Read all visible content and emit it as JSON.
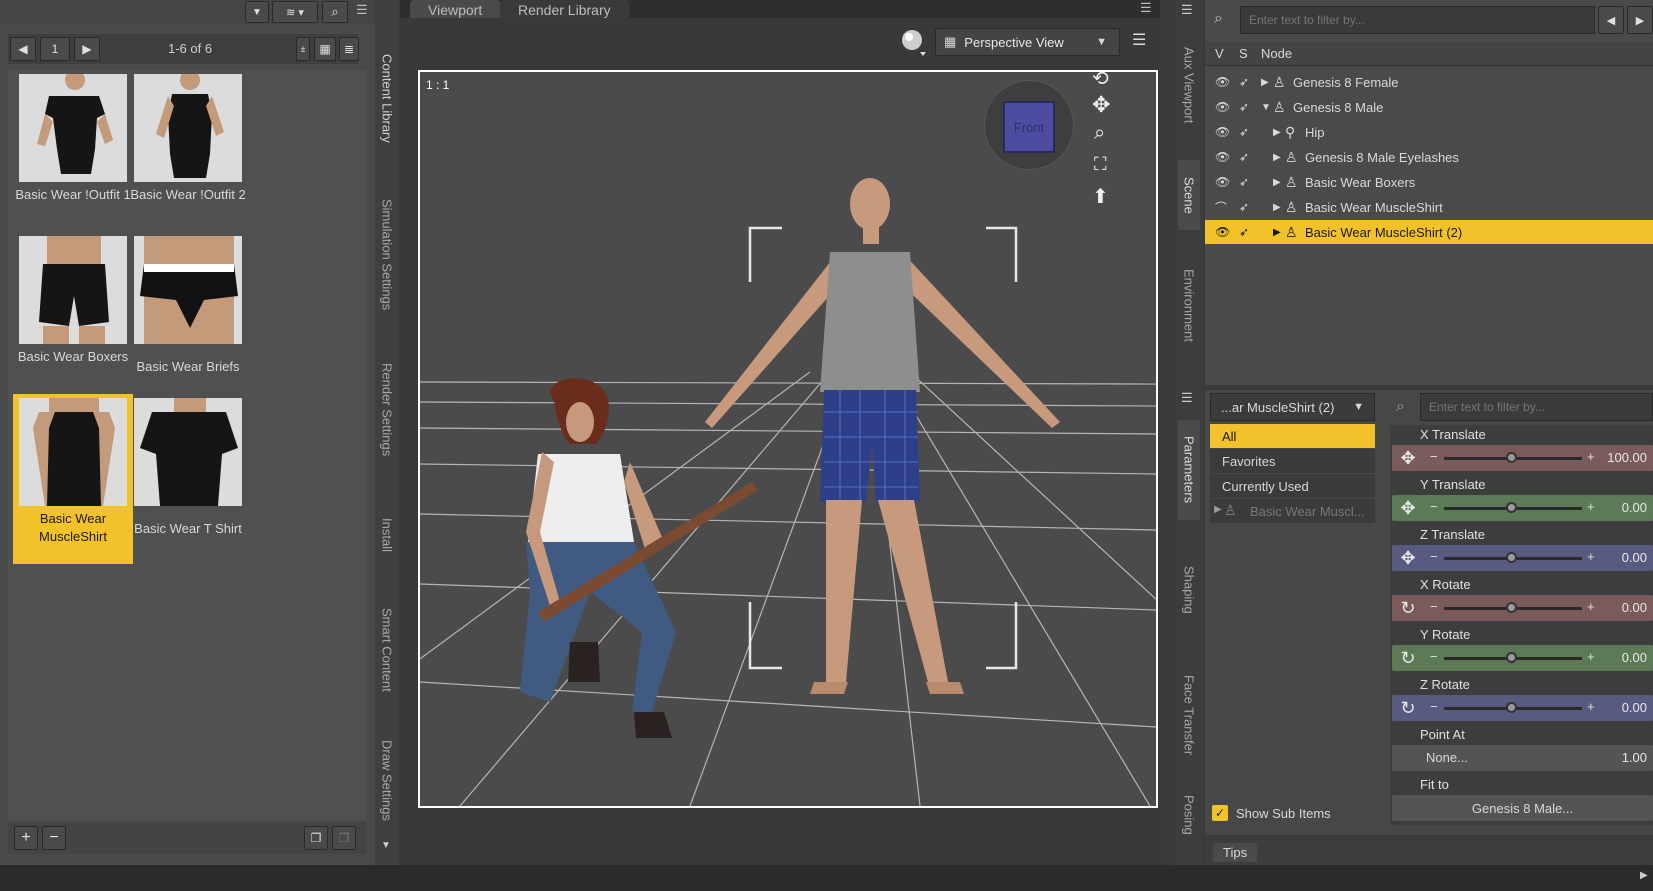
{
  "library": {
    "page_number": "1",
    "range_label": "1-6 of 6",
    "items": [
      {
        "label": "Basic Wear !Outfit 1"
      },
      {
        "label": "Basic Wear !Outfit 2"
      },
      {
        "label": "Basic Wear Boxers"
      },
      {
        "label": "Basic Wear Briefs"
      },
      {
        "label": "Basic Wear MuscleShirt",
        "selected": true
      },
      {
        "label": "Basic Wear T Shirt"
      }
    ]
  },
  "left_tabs": [
    "Content Library",
    "Simulation Settings",
    "Render Settings",
    "Install",
    "Smart Content",
    "Draw Settings"
  ],
  "viewport": {
    "tabs": [
      "Viewport",
      "Render Library"
    ],
    "view_mode": "Perspective View",
    "aspect_label": "1 : 1",
    "cube_label": "Front"
  },
  "right_tabs": [
    "Aux Viewport",
    "Scene",
    "Environment",
    "Parameters",
    "Shaping",
    "Face Transfer",
    "Posing"
  ],
  "scene": {
    "filter_placeholder": "Enter text to filter by...",
    "header": {
      "v": "V",
      "s": "S",
      "node": "Node"
    },
    "nodes": [
      {
        "label": "Genesis 8 Female",
        "depth": 0,
        "expanded": false
      },
      {
        "label": "Genesis 8 Male",
        "depth": 0,
        "expanded": true
      },
      {
        "label": "Hip",
        "depth": 1,
        "expanded": false
      },
      {
        "label": "Genesis 8 Male Eyelashes",
        "depth": 1,
        "expanded": false
      },
      {
        "label": "Basic Wear Boxers",
        "depth": 1,
        "expanded": false
      },
      {
        "label": "Basic Wear MuscleShirt",
        "depth": 1,
        "expanded": false
      },
      {
        "label": "Basic Wear MuscleShirt (2)",
        "depth": 1,
        "expanded": false,
        "selected": true
      }
    ]
  },
  "parameters": {
    "node_selector": "...ar MuscleShirt (2)",
    "filter_placeholder": "Enter text to filter by...",
    "categories": [
      "All",
      "Favorites",
      "Currently Used",
      "Basic Wear Muscl..."
    ],
    "show_sub_items_label": "Show Sub Items",
    "properties": [
      {
        "name": "X Translate",
        "value": "100.00",
        "color": "#7a5a5a",
        "icon": "move-icon"
      },
      {
        "name": "Y Translate",
        "value": "0.00",
        "color": "#5b7a55",
        "icon": "move-icon"
      },
      {
        "name": "Z Translate",
        "value": "0.00",
        "color": "#585a80",
        "icon": "move-icon"
      },
      {
        "name": "X Rotate",
        "value": "0.00",
        "color": "#7a5a5a",
        "icon": "rotate-icon"
      },
      {
        "name": "Y Rotate",
        "value": "0.00",
        "color": "#5b7a55",
        "icon": "rotate-icon"
      },
      {
        "name": "Z Rotate",
        "value": "0.00",
        "color": "#585a80",
        "icon": "rotate-icon"
      }
    ],
    "point_at": {
      "name": "Point At",
      "value": "None...",
      "number": "1.00"
    },
    "fit_to": {
      "name": "Fit to",
      "value": "Genesis 8 Male..."
    }
  },
  "tips_label": "Tips",
  "colors": {
    "selection": "#f2c22a"
  }
}
